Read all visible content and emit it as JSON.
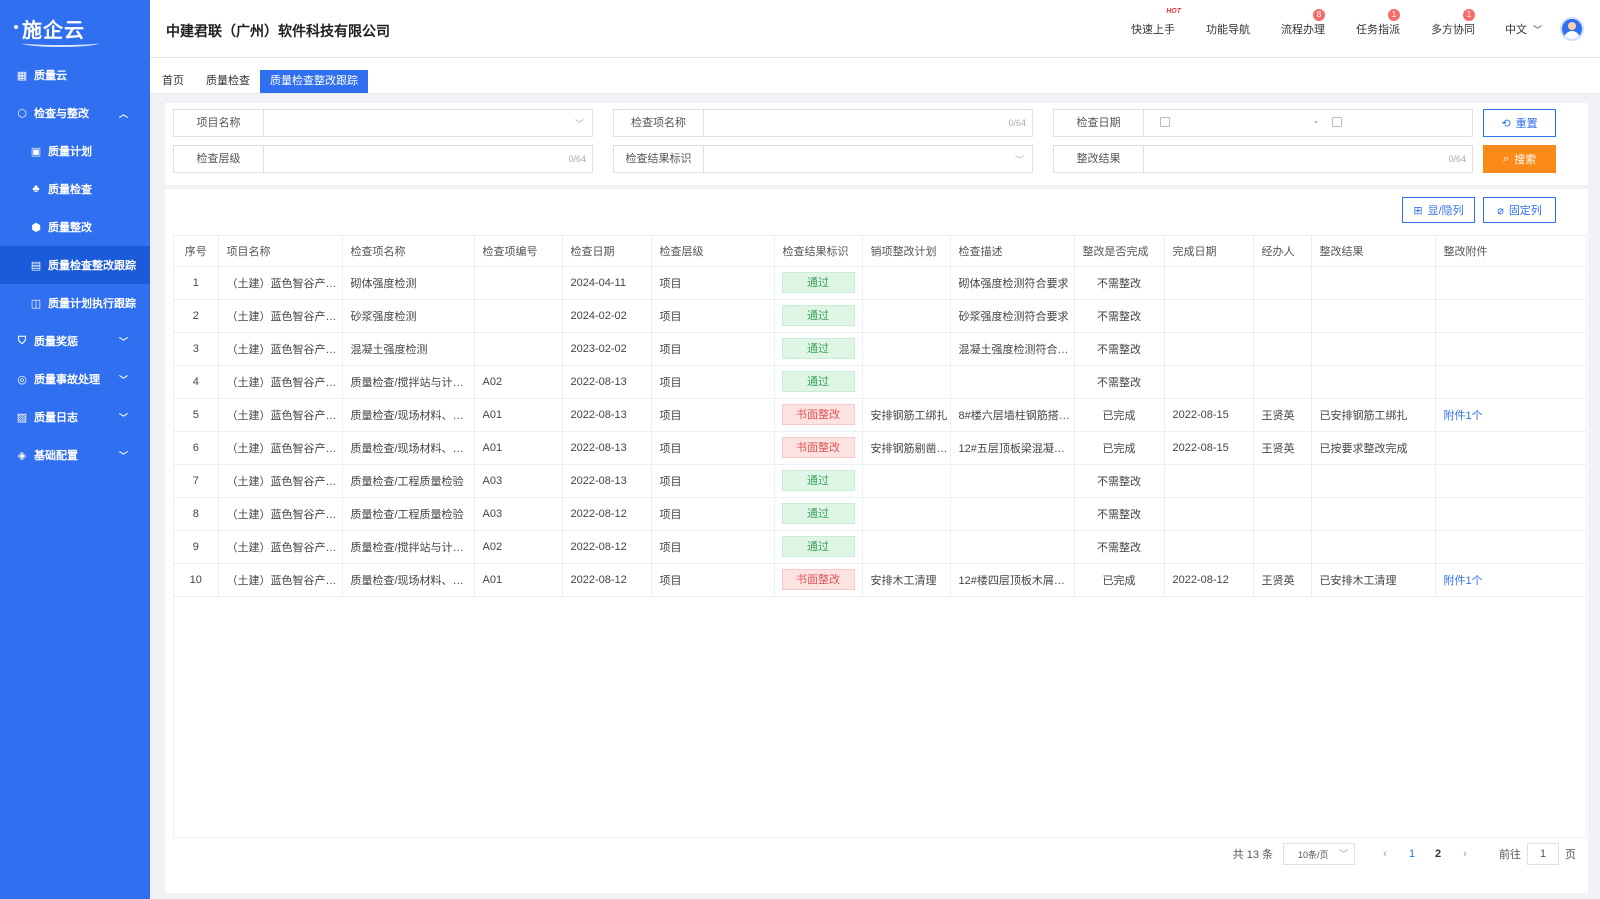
{
  "app": {
    "logo_text": "施企云",
    "company": "中建君联（广州）软件科技有限公司"
  },
  "header_nav": [
    {
      "label": "快速上手",
      "badge": "HOT"
    },
    {
      "label": "功能导航",
      "badge": ""
    },
    {
      "label": "流程办理",
      "badge": "8"
    },
    {
      "label": "任务指派",
      "badge": "1"
    },
    {
      "label": "多方协同",
      "badge": "1"
    }
  ],
  "language": "中文",
  "sidebar": {
    "items": [
      {
        "label": "质量云",
        "icon": "grid-icon",
        "chevron": ""
      },
      {
        "label": "检查与整改",
        "icon": "cube-icon",
        "chevron": "︿"
      },
      {
        "label": "质量计划",
        "icon": "clipboard-icon",
        "chevron": "",
        "sub": true
      },
      {
        "label": "质量检查",
        "icon": "org-icon",
        "chevron": "",
        "sub": true
      },
      {
        "label": "质量整改",
        "icon": "box-icon",
        "chevron": "",
        "sub": true
      },
      {
        "label": "质量检查整改跟踪",
        "icon": "calendar-icon",
        "chevron": "",
        "sub": true,
        "active": true
      },
      {
        "label": "质量计划执行跟踪",
        "icon": "chart-icon",
        "chevron": "",
        "sub": true
      },
      {
        "label": "质量奖惩",
        "icon": "shield-icon",
        "chevron": "﹀"
      },
      {
        "label": "质量事故处理",
        "icon": "target-icon",
        "chevron": "﹀"
      },
      {
        "label": "质量日志",
        "icon": "log-icon",
        "chevron": "﹀"
      },
      {
        "label": "基础配置",
        "icon": "layers-icon",
        "chevron": "﹀"
      }
    ]
  },
  "tabs": [
    {
      "label": "首页"
    },
    {
      "label": "质量检查"
    },
    {
      "label": "质量检查整改跟踪"
    }
  ],
  "filters": {
    "project_name": {
      "label": "项目名称",
      "value": ""
    },
    "item_name": {
      "label": "检查项名称",
      "counter": "0/64"
    },
    "check_date": {
      "label": "检查日期",
      "separator": "-"
    },
    "level": {
      "label": "检查层级",
      "counter": "0/64"
    },
    "result_flag": {
      "label": "检查结果标识",
      "value": ""
    },
    "fix_result": {
      "label": "整改结果",
      "counter": "0/64"
    },
    "reset_label": "重置",
    "search_label": "搜索"
  },
  "toolbar": {
    "toggle_cols": "显/隐列",
    "fix_cols": "固定列"
  },
  "table": {
    "columns": [
      "序号",
      "项目名称",
      "检查项名称",
      "检查项编号",
      "检查日期",
      "检查层级",
      "检查结果标识",
      "销项整改计划",
      "检查描述",
      "整改是否完成",
      "完成日期",
      "经办人",
      "整改结果",
      "整改附件"
    ],
    "rows": [
      [
        "1",
        "（土建）蓝色智谷产…",
        "砌体强度检测",
        "",
        "2024-04-11",
        "项目",
        "通过",
        "",
        "砌体强度检测符合要求",
        "不需整改",
        "",
        "",
        "",
        ""
      ],
      [
        "2",
        "（土建）蓝色智谷产…",
        "砂浆强度检测",
        "",
        "2024-02-02",
        "项目",
        "通过",
        "",
        "砂浆强度检测符合要求",
        "不需整改",
        "",
        "",
        "",
        ""
      ],
      [
        "3",
        "（土建）蓝色智谷产…",
        "混凝土强度检测",
        "",
        "2023-02-02",
        "项目",
        "通过",
        "",
        "混凝土强度检测符合…",
        "不需整改",
        "",
        "",
        "",
        ""
      ],
      [
        "4",
        "（土建）蓝色智谷产…",
        "质量检查/搅拌站与计量…",
        "A02",
        "2022-08-13",
        "项目",
        "通过",
        "",
        "",
        "不需整改",
        "",
        "",
        "",
        ""
      ],
      [
        "5",
        "（土建）蓝色智谷产…",
        "质量检查/现场材料、设…",
        "A01",
        "2022-08-13",
        "项目",
        "书面整改",
        "安排钢筋工绑扎",
        "8#楼六层墙柱钢筋搭…",
        "已完成",
        "2022-08-15",
        "王贤英",
        "已安排钢筋工绑扎",
        "附件1个"
      ],
      [
        "6",
        "（土建）蓝色智谷产…",
        "质量检查/现场材料、设…",
        "A01",
        "2022-08-13",
        "项目",
        "书面整改",
        "安排钢筋剔凿…",
        "12#五层顶板梁混凝…",
        "已完成",
        "2022-08-15",
        "王贤英",
        "已按要求整改完成",
        ""
      ],
      [
        "7",
        "（土建）蓝色智谷产…",
        "质量检查/工程质量检验",
        "A03",
        "2022-08-13",
        "项目",
        "通过",
        "",
        "",
        "不需整改",
        "",
        "",
        "",
        ""
      ],
      [
        "8",
        "（土建）蓝色智谷产…",
        "质量检查/工程质量检验",
        "A03",
        "2022-08-12",
        "项目",
        "通过",
        "",
        "",
        "不需整改",
        "",
        "",
        "",
        ""
      ],
      [
        "9",
        "（土建）蓝色智谷产…",
        "质量检查/搅拌站与计量…",
        "A02",
        "2022-08-12",
        "项目",
        "通过",
        "",
        "",
        "不需整改",
        "",
        "",
        "",
        ""
      ],
      [
        "10",
        "（土建）蓝色智谷产…",
        "质量检查/现场材料、设…",
        "A01",
        "2022-08-12",
        "项目",
        "书面整改",
        "安排木工清理",
        "12#楼四层顶板木屑…",
        "已完成",
        "2022-08-12",
        "王贤英",
        "已安排木工清理",
        "附件1个"
      ]
    ]
  },
  "pagination": {
    "total_text": "共 13 条",
    "page_size": "10条/页",
    "pages": [
      "1",
      "2"
    ],
    "current": "1",
    "goto_label": "前往",
    "goto_value": "1",
    "page_suffix": "页"
  },
  "colors": {
    "primary": "#2f6ff0",
    "search": "#fb8a19",
    "pass": "#3aa35c",
    "fix": "#e05656"
  }
}
